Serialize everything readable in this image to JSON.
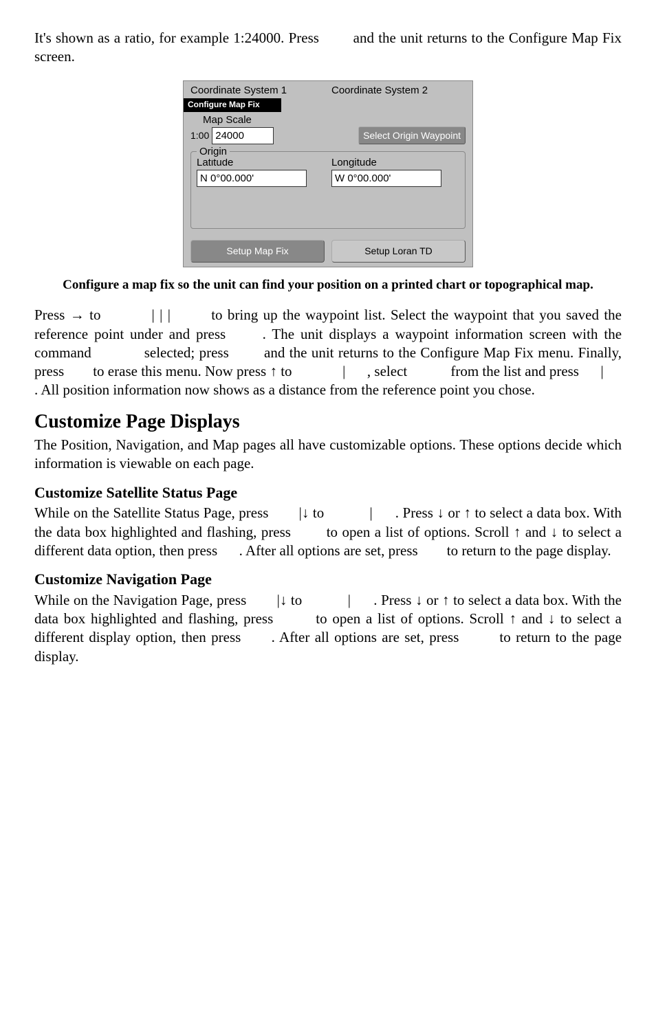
{
  "intro": {
    "line1_pre": "It's shown as a ratio, for example 1:24000. Press ",
    "line1_post": "and the unit returns to the Configure Map Fix screen."
  },
  "screenshot": {
    "coord_sys_1": "Coordinate System 1",
    "coord_sys_2": "Coordinate System 2",
    "title_bar": "Configure Map Fix",
    "map_scale_label": "Map Scale",
    "scale_prefix": "1:00",
    "scale_value": "24000",
    "select_origin_btn": "Select Origin Waypoint",
    "origin_legend": "Origin",
    "latitude_label": "Latitude",
    "longitude_label": "Longitude",
    "lat_value": "N     0°00.000'",
    "lon_value": "W     0°00.000'",
    "setup_map_fix_btn": "Setup Map Fix",
    "setup_loran_btn": "Setup Loran TD"
  },
  "caption": "Configure a map fix so the unit can find your position on a printed chart or topographical map.",
  "para2": {
    "press_arrow_to": "Press → to ",
    "bars1": "|       |       |",
    "bring_up": " to bring up the waypoint list. Select the waypoint that you saved the reference point under and press",
    "unit_displays": ". The unit displays a waypoint information screen with the command ",
    "selected_press": "selected; press ",
    "and_returns": "and the unit returns to the Configure Map Fix menu. Finally, press ",
    "to_erase": "to erase this menu. Now press ↑ to ",
    "bar2": "|",
    "select": ", select ",
    "from_list": "from the list and press ",
    "bar3": "|",
    "all_pos": ". All position information now shows as a distance from the reference point you chose."
  },
  "h_customize": "Customize Page Displays",
  "para3": "The Position, Navigation, and Map pages all have customizable options. These options decide which information is viewable on each page.",
  "h_sat": "Customize Satellite Status Page",
  "para_sat": {
    "a": "While on the Satellite Status Page, press ",
    "b": "|↓ to ",
    "c": "|",
    "d": ". Press ↓ or ↑ to select a data box. With the data box highlighted and flashing, press ",
    "e": "to open a list of options. Scroll ↑ and ↓ to select a different data option, then press ",
    "f": ". After all options are set, press ",
    "g": "to return to the page display."
  },
  "h_nav": "Customize Navigation Page",
  "para_nav": {
    "a": "While on the Navigation Page, press ",
    "b": "|↓ to ",
    "c": "|",
    "d": ". Press ↓ or ↑ to select a data box. With the data box highlighted and flashing, press ",
    "e": "to open a list of options. Scroll ↑ and ↓ to select a different display option, then press ",
    "f": ". After all options are set, press ",
    "g": "to return to the page display."
  }
}
